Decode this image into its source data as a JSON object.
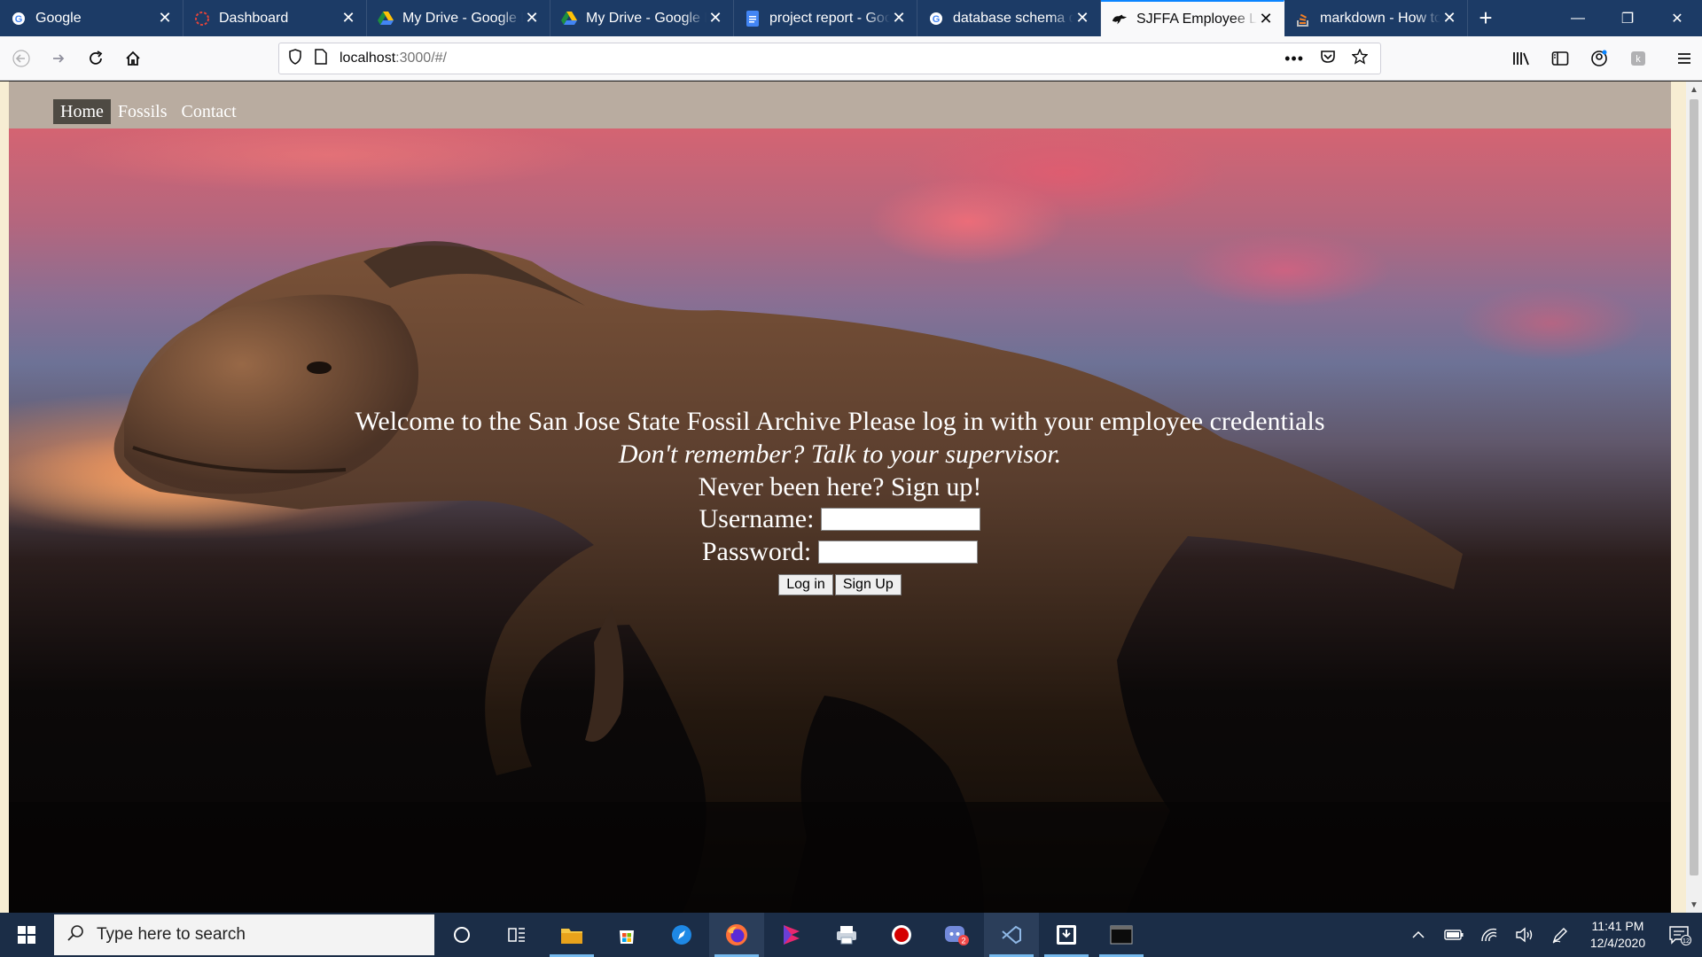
{
  "browser": {
    "tabs": [
      {
        "title": "Google",
        "icon": "google-icon",
        "active": false
      },
      {
        "title": "Dashboard",
        "icon": "dashboard-icon",
        "active": false
      },
      {
        "title": "My Drive - Google Drive",
        "icon": "google-drive-icon",
        "active": false
      },
      {
        "title": "My Drive - Google Drive",
        "icon": "google-drive-icon",
        "active": false
      },
      {
        "title": "project report - Google Docs",
        "icon": "google-docs-icon",
        "active": false
      },
      {
        "title": "database schema diagram",
        "icon": "google-icon",
        "active": false
      },
      {
        "title": "SJFFA Employee Login",
        "icon": "dino-icon",
        "active": true
      },
      {
        "title": "markdown - How to",
        "icon": "stackoverflow-icon",
        "active": false
      }
    ],
    "url_host": "localhost",
    "url_rest": ":3000/#/"
  },
  "site": {
    "nav": [
      "Home",
      "Fossils",
      "Contact"
    ],
    "active_nav": "Home",
    "welcome": "Welcome to the San Jose State Fossil Archive Please log in with your employee credentials",
    "remember": "Don't remember? Talk to your supervisor.",
    "signup_text": "Never been here? Sign up!",
    "username_label": "Username:",
    "password_label": "Password:",
    "username_value": "",
    "password_value": "",
    "login_button": "Log in",
    "signup_button": "Sign Up"
  },
  "taskbar": {
    "search_placeholder": "Type here to search",
    "time": "11:41 PM",
    "date": "12/4/2020",
    "notification_count": "12",
    "discord_badge": "2"
  },
  "colors": {
    "tabstrip": "#1c3b66",
    "active_tab_accent": "#0a84ff",
    "site_nav_bg": "#b9aca0",
    "site_nav_active": "#4e4a43",
    "taskbar": "#1b2d47"
  }
}
